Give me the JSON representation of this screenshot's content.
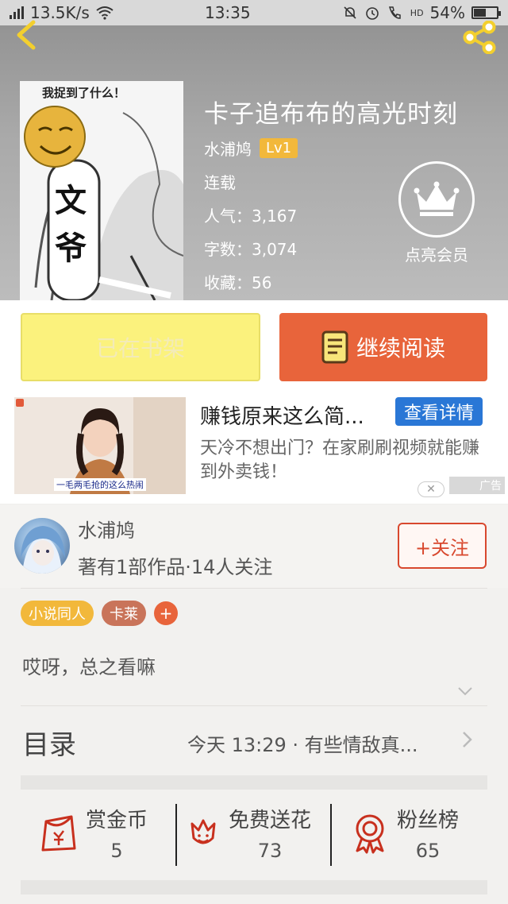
{
  "status_bar": {
    "network": "4G",
    "speed": "13.5K/s",
    "time": "13:35",
    "hd": "HD",
    "battery": "54%",
    "battery_level": 0.54
  },
  "book": {
    "title": "卡子追布布的高光时刻",
    "author": "水浦鸠",
    "level": "Lv1",
    "status": "连载",
    "popularity_label": "人气：",
    "popularity": "3,167",
    "words_label": "字数：",
    "words": "3,074",
    "favorites_label": "收藏：",
    "favorites": "56",
    "vip_label": "点亮会员",
    "cover_caption_top": "我捉到了什么！",
    "cover_caption_left": "文",
    "cover_caption_right": "爷"
  },
  "actions": {
    "shelf_label": "已在书架",
    "read_label": "继续阅读"
  },
  "ad": {
    "title": "赚钱原来这么简...",
    "detail_label": "查看详情",
    "description": "天冷不想出门？在家刷刷视频就能赚到外卖钱！",
    "image_caption": "一毛两毛抢的这么热闹",
    "close": "✕",
    "tag": "广告"
  },
  "author_section": {
    "name": "水浦鸠",
    "stats": "著有1部作品·14人关注",
    "follow_label": "+关注"
  },
  "tags": [
    {
      "label": "小说同人",
      "color": "#f2b83b"
    },
    {
      "label": "卡莱",
      "color": "#c9745a"
    }
  ],
  "tag_add": "+",
  "intro": "哎呀，总之看嘛",
  "toc": {
    "label": "目录",
    "latest": "今天 13:29 · 有些情敌真..."
  },
  "stats": [
    {
      "label": "赏金币",
      "value": "5"
    },
    {
      "label": "免费送花",
      "value": "73"
    },
    {
      "label": "粉丝榜",
      "value": "65"
    }
  ],
  "colors": {
    "accent": "#e8643b",
    "shelf_yellow": "#fbf27d",
    "level_badge": "#f2b83b",
    "ad_blue": "#2a77d6",
    "icon_red": "#c8301e"
  }
}
